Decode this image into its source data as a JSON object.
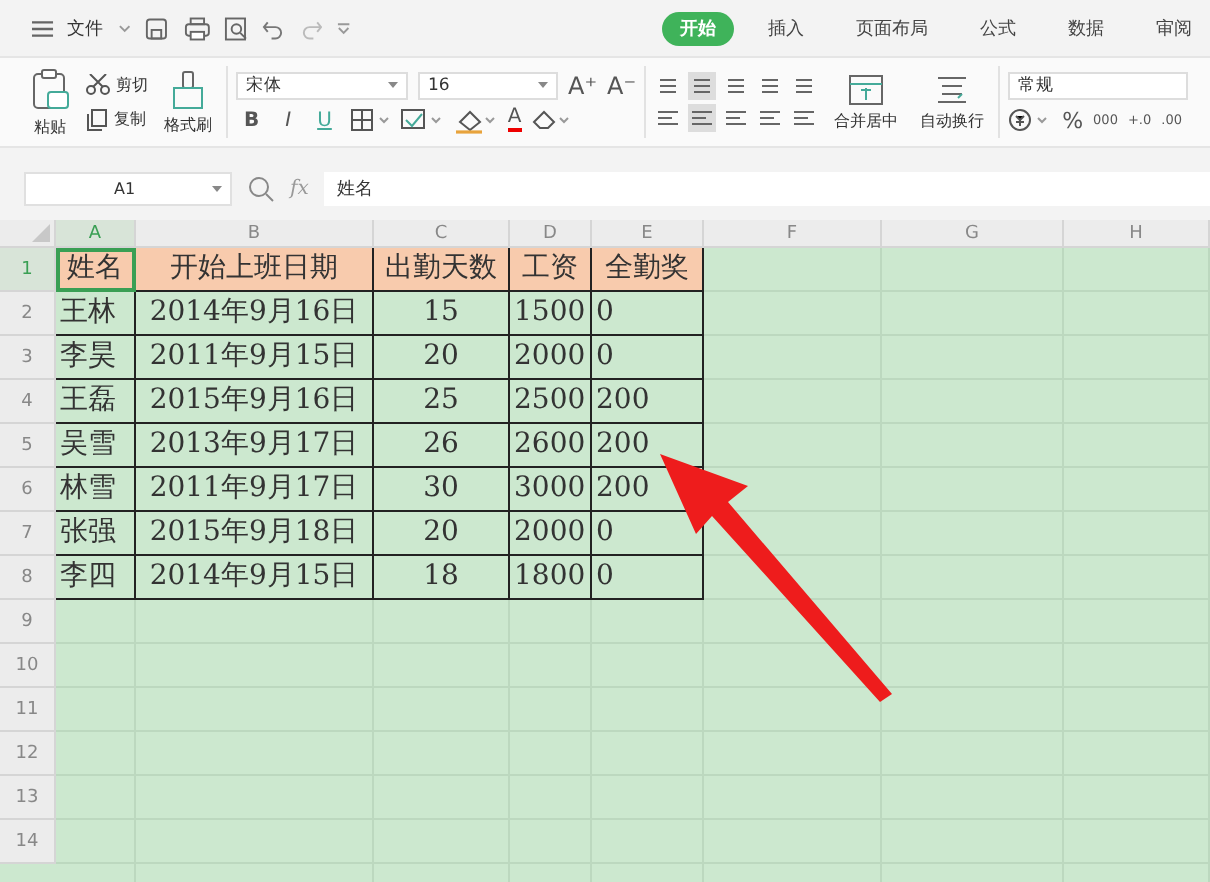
{
  "menu": {
    "label": "文件"
  },
  "tabs": [
    {
      "label": "开始",
      "selected": true
    },
    {
      "label": "插入",
      "selected": false
    },
    {
      "label": "页面布局",
      "selected": false
    },
    {
      "label": "公式",
      "selected": false
    },
    {
      "label": "数据",
      "selected": false
    },
    {
      "label": "审阅",
      "selected": false
    }
  ],
  "ribbon": {
    "paste": "粘贴",
    "cut": "剪切",
    "copy": "复制",
    "format_painter": "格式刷",
    "font": "宋体",
    "font_size": "16",
    "size_buttons": [
      "A⁺",
      "A⁻"
    ],
    "style_buttons": [
      "B",
      "I",
      "U"
    ],
    "font_color": "A",
    "merge": "合并居中",
    "wrap": "自动换行",
    "number_format": "常规",
    "number_buttons": [
      "%",
      "000",
      "+.0",
      ".00"
    ]
  },
  "formula_bar": {
    "name_box": "A1",
    "fx": "fx",
    "value": "姓名"
  },
  "sheet": {
    "columns": [
      "A",
      "B",
      "C",
      "D",
      "E",
      "F",
      "G",
      "H"
    ],
    "row_numbers": [
      "1",
      "2",
      "3",
      "4",
      "5",
      "6",
      "7",
      "8",
      "9",
      "10",
      "11",
      "12",
      "13",
      "14"
    ],
    "header": [
      "姓名",
      "开始上班日期",
      "出勤天数",
      "工资",
      "全勤奖"
    ],
    "rows": [
      [
        "王林",
        "2014年9月16日",
        "15",
        "1500",
        "0"
      ],
      [
        "李昊",
        "2011年9月15日",
        "20",
        "2000",
        "0"
      ],
      [
        "王磊",
        "2015年9月16日",
        "25",
        "2500",
        "200"
      ],
      [
        "吴雪",
        "2013年9月17日",
        "26",
        "2600",
        "200"
      ],
      [
        "林雪",
        "2011年9月17日",
        "30",
        "3000",
        "200"
      ],
      [
        "张强",
        "2015年9月18日",
        "20",
        "2000",
        "0"
      ],
      [
        "李四",
        "2014年9月15日",
        "18",
        "1800",
        "0"
      ]
    ]
  }
}
